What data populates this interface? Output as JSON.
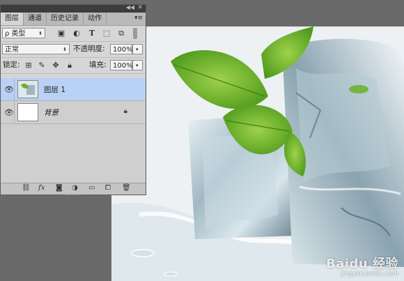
{
  "panel": {
    "tabs": [
      {
        "label": "图层",
        "active": true
      },
      {
        "label": "通道",
        "active": false
      },
      {
        "label": "历史记录",
        "active": false
      },
      {
        "label": "动作",
        "active": false
      }
    ],
    "filter": {
      "kind_label": "ρ 类型"
    },
    "blend": {
      "mode": "正常",
      "opacity_label": "不透明度:",
      "opacity_value": "100%"
    },
    "lock": {
      "label": "锁定:",
      "fill_label": "填充:",
      "fill_value": "100%"
    },
    "layers": [
      {
        "name": "图层 1",
        "selected": true,
        "locked": false
      },
      {
        "name": "背景",
        "selected": false,
        "locked": true
      }
    ]
  },
  "canvas": {
    "watermark_logo": "Baidu 经验",
    "watermark_url": "jingyan.baidu.com"
  },
  "colors": {
    "panel_bg": "#d6d6d6",
    "selected_row": "#b8d1f5",
    "workspace": "#6a6a6a"
  }
}
